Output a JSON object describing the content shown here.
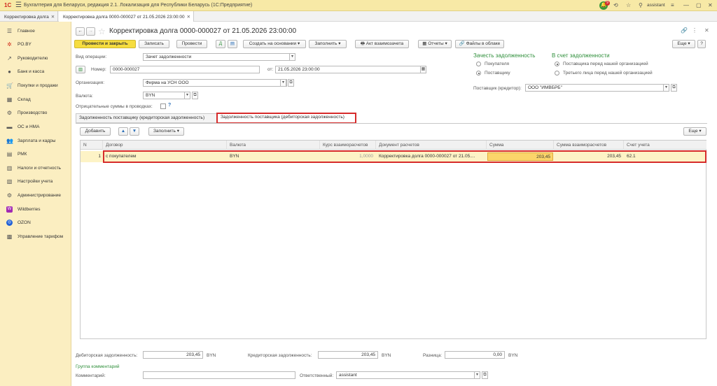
{
  "titlebar": {
    "logo": "1С",
    "title": "Бухгалтерия для Беларуси, редакция 2.1. Локализация для Республики Беларусь   (1С:Предприятие)",
    "notif_count": "9",
    "user": "assistant"
  },
  "window_tabs": [
    {
      "label": "Корректировка долга"
    },
    {
      "label": "Корректировка долга 0000-000027 от 21.05.2026 23:00:00"
    }
  ],
  "sidebar": {
    "items": [
      {
        "label": "Главное",
        "icon": "menu-icon"
      },
      {
        "label": "PO.BY",
        "icon": "poby-icon"
      },
      {
        "label": "Руководителю",
        "icon": "chart-icon"
      },
      {
        "label": "Банк и касса",
        "icon": "coin-icon"
      },
      {
        "label": "Покупки и продажи",
        "icon": "cart-icon"
      },
      {
        "label": "Склад",
        "icon": "warehouse-icon"
      },
      {
        "label": "Производство",
        "icon": "factory-icon"
      },
      {
        "label": "ОС и НМА",
        "icon": "car-icon"
      },
      {
        "label": "Зарплата и кадры",
        "icon": "people-icon"
      },
      {
        "label": "РМК",
        "icon": "register-icon"
      },
      {
        "label": "Налоги и отчетность",
        "icon": "tax-icon"
      },
      {
        "label": "Настройки учета",
        "icon": "settings-doc-icon"
      },
      {
        "label": "Администрирование",
        "icon": "gear-icon"
      },
      {
        "label": "Wildberries",
        "icon": "wildberries-icon"
      },
      {
        "label": "OZON",
        "icon": "ozon-icon"
      },
      {
        "label": "Управление тарифом",
        "icon": "tariff-icon"
      }
    ]
  },
  "form": {
    "title": "Корректировка долга 0000-000027 от 21.05.2026 23:00:00",
    "toolbar": {
      "post_close": "Провести и закрыть",
      "save": "Записать",
      "post": "Провести",
      "create_based": "Создать на основании",
      "fill": "Заполнить",
      "act": "Акт взаимозачета",
      "reports": "Отчеты",
      "files": "Файлы в облаке",
      "more": "Еще"
    },
    "operation_label": "Вид операции:",
    "operation_value": "Зачет задолженности",
    "number_label": "Номер:",
    "number_value": "0000-000027",
    "date_label": "от:",
    "date_value": "21.05.2026 23:00:00",
    "org_label": "Организация:",
    "org_value": "Фирма на УСН ООО",
    "currency_label": "Валюта:",
    "currency_value": "BYN",
    "negative_label": "Отрицательные суммы в проводках:",
    "help": "?",
    "offset_title": "Зачесть задолженность",
    "offset_buyer": "Покупателя",
    "offset_supplier": "Поставщику",
    "account_title": "В счет задолженности",
    "account_supplier": "Поставщика перед нашей организацией",
    "account_third": "Третьего лица перед нашей организацией",
    "supplier_label": "Поставщик (кредитор):",
    "supplier_value": "ООО \"ИМВБРБ\"",
    "tab1": "Задолженность поставщику (кредиторская задолженность)",
    "tab2": "Задолженность поставщика (дебиторская задолженность)",
    "table_add": "Добавить",
    "table_fill": "Заполнить",
    "table_more": "Еще",
    "columns": {
      "n": "N",
      "contract": "Договор",
      "currency": "Валюта",
      "rate": "Курс взаиморасчетов",
      "doc": "Документ расчетов",
      "sum": "Сумма",
      "sum_mutual": "Сумма взаиморасчетов",
      "account": "Счет учета"
    },
    "row": {
      "n": "1",
      "contract": "с покупателем",
      "currency": "BYN",
      "rate": "1,0000",
      "doc": "Корректировка долга 0000-000027 от 21.05....",
      "sum": "203,45",
      "sum_mutual": "203,45",
      "account": "62.1"
    },
    "debit_label": "Дебиторская задолженность:",
    "debit_value": "203,45",
    "credit_label": "Кредиторская задолженность:",
    "credit_value": "203,45",
    "diff_label": "Разница:",
    "diff_value": "0,00",
    "byn": "BYN",
    "comments_group": "Группа комментарий",
    "comment_label": "Комментарий:",
    "comment_value": "",
    "responsible_label": "Ответственный:",
    "responsible_value": "assistant"
  },
  "colors": {
    "sidebar_bg": "#fbeec1",
    "titlebar_bg": "#f7e9a6",
    "primary_button": "#f6dd3f",
    "highlight_row": "#fdf3c6",
    "selected_cell": "#fbd56a",
    "annotation_red": "#d62b2b",
    "accent_green": "#2f8f3b"
  }
}
